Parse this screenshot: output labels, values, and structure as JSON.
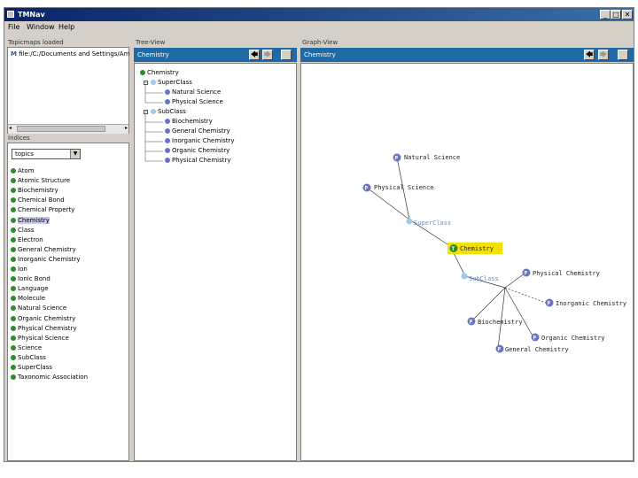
{
  "window": {
    "title": "TMNav",
    "controls": [
      "_",
      "□",
      "✕"
    ]
  },
  "menu": [
    "File",
    "Window",
    "Help"
  ],
  "topicmaps_panel": {
    "title": "Topicmaps loaded",
    "item": "file:/C:/Documents and Settings/Am"
  },
  "indices_panel": {
    "title": "Indices",
    "select_value": "topics",
    "selected_topic": "Chemistry",
    "topics": [
      "Atom",
      "Atomic Structure",
      "Biochemistry",
      "Chemical Bond",
      "Chemical Property",
      "Chemistry",
      "Class",
      "Electron",
      "General Chemistry",
      "Inorganic Chemistry",
      "Ion",
      "Ionic Bond",
      "Language",
      "Molecule",
      "Natural Science",
      "Organic Chemistry",
      "Physical Chemistry",
      "Physical Science",
      "Science",
      "SubClass",
      "SuperClass",
      "Taxonomic Association"
    ]
  },
  "tree_view": {
    "title": "Tree-View",
    "header": "Chemistry",
    "root": "Chemistry",
    "superclass_label": "SuperClass",
    "superclasses": [
      "Natural Science",
      "Physical Science"
    ],
    "subclass_label": "SubClass",
    "subclasses": [
      "Biochemistry",
      "General Chemistry",
      "Inorganic Chemistry",
      "Organic Chemistry",
      "Physical Chemistry"
    ]
  },
  "graph_view": {
    "title": "Graph-View",
    "header": "Chemistry",
    "center": "Chemistry",
    "assoc_super": "SuperClass",
    "assoc_sub": "SubClass",
    "node_natural_science": "Natural Science",
    "node_physical_science": "Physical Science",
    "node_physical_chemistry": "Physical Chemistry",
    "node_inorganic_chemistry": "Inorganic Chemistry",
    "node_biochemistry": "Biochemistry",
    "node_organic_chemistry": "Organic Chemistry",
    "node_general_chemistry": "General Chemistry",
    "highlight_color": "#f5e100"
  },
  "nav": {
    "back": "🡄",
    "forward": "🡆"
  }
}
